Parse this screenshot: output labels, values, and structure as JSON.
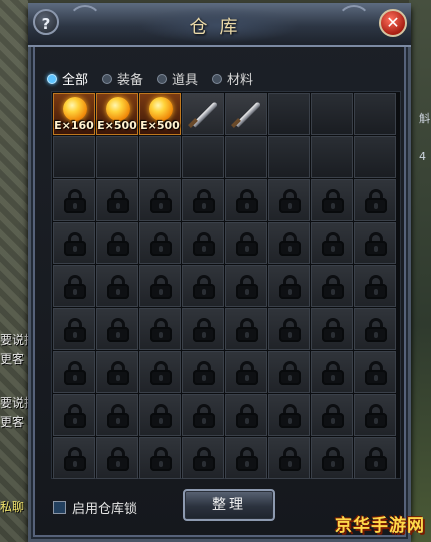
{
  "window": {
    "title": "仓库"
  },
  "buttons": {
    "help": "?",
    "close": "✕",
    "sort": "整理"
  },
  "tabs": [
    {
      "label": "全部",
      "active": true
    },
    {
      "label": "装备",
      "active": false
    },
    {
      "label": "道具",
      "active": false
    },
    {
      "label": "材料",
      "active": false
    }
  ],
  "grid": {
    "columns": 8,
    "rows": 9,
    "unlocked_rows": 2,
    "items": [
      {
        "slot": 0,
        "type": "exp-orb",
        "label": "E×160"
      },
      {
        "slot": 1,
        "type": "exp-orb",
        "label": "E×500"
      },
      {
        "slot": 2,
        "type": "exp-orb",
        "label": "E×500"
      },
      {
        "slot": 3,
        "type": "blade",
        "label": ""
      },
      {
        "slot": 4,
        "type": "blade",
        "label": ""
      }
    ]
  },
  "bottom": {
    "lock_checkbox_label": "启用仓库锁",
    "lock_checked": false
  },
  "background": {
    "chat_fragments": [
      "要说掉",
      "更客",
      "要说掉",
      "更客",
      "私聊"
    ],
    "side_fragments": [
      "斛",
      "4"
    ]
  },
  "watermark": "京华手游网",
  "colors": {
    "accent": "#5fc4ff",
    "close": "#c8261a",
    "watermark": "#ffd84a"
  }
}
